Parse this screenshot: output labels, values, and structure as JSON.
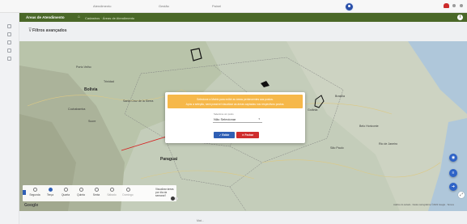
{
  "header": {
    "logo_text": "",
    "nav": [
      "Atendimento",
      "Gestão",
      "Painel"
    ],
    "colors": {
      "avatar": "#2a4fa8",
      "bell": "#cc2b2b"
    }
  },
  "breadcrumb": {
    "title": "Áreas de Atendimento",
    "path": "Cadastros · Áreas de Atendimento"
  },
  "filters": {
    "label": "Filtros avançados"
  },
  "map": {
    "labels": [
      {
        "text": "Bolivia",
        "big": true
      },
      {
        "text": "Paraguai",
        "big": true
      },
      {
        "text": "Santa Cruz de la Sierra",
        "big": false
      },
      {
        "text": "Cochabamba",
        "big": false
      },
      {
        "text": "Sucre",
        "big": false
      },
      {
        "text": "Brasília",
        "big": false
      },
      {
        "text": "Goiânia",
        "big": false
      },
      {
        "text": "Belo Horizonte",
        "big": false
      },
      {
        "text": "Rio de Janeiro",
        "big": false
      },
      {
        "text": "São Paulo",
        "big": false
      },
      {
        "text": "Campo Grande",
        "big": false
      },
      {
        "text": "Cuiabá",
        "big": false
      },
      {
        "text": "Porto Velho",
        "big": false
      },
      {
        "text": "Trinidad",
        "big": false
      }
    ],
    "google": "Google",
    "attribution": "Atalhos do teclado · Dados cartográficos ©2023 Google · Termos"
  },
  "modal": {
    "notice_line1": "Selecione a Matriz para exibir as áreas pertencentes aos postos.",
    "notice_line2": "Após a seleção, será possível visualizar as áreas captadas nos respectivos postos.",
    "select_label": "Selecione um posto",
    "select_value": "Não Selecionar",
    "confirm_label": "✓ Exibir",
    "close_label": "✕ Fechar"
  },
  "days": {
    "items": [
      {
        "label": "Segunda",
        "checked": false,
        "disabled": false
      },
      {
        "label": "Terça",
        "checked": true,
        "disabled": false
      },
      {
        "label": "Quarta",
        "checked": false,
        "disabled": false
      },
      {
        "label": "Quinta",
        "checked": false,
        "disabled": false
      },
      {
        "label": "Sexta",
        "checked": false,
        "disabled": false
      },
      {
        "label": "Sábado",
        "checked": false,
        "disabled": true
      },
      {
        "label": "Domingo",
        "checked": false,
        "disabled": true
      }
    ],
    "toggle_label": "Visualizar áreas por dia da semana?"
  },
  "footer": {
    "text": "Mat..."
  }
}
